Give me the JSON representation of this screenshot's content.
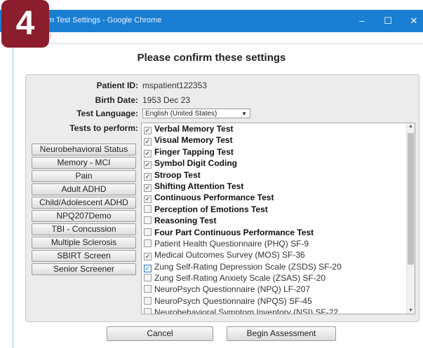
{
  "window": {
    "title": "m Test Settings - Google Chrome",
    "address": "//",
    "controls": [
      "–",
      "☐",
      "✕"
    ]
  },
  "step_badge": "4",
  "heading": "Please confirm these settings",
  "patient": {
    "id_label": "Patient ID:",
    "id_value": "mspatient122353",
    "birth_label": "Birth Date:",
    "birth_value": "1953 Dec 23",
    "language_label": "Test Language:",
    "language_value": "English (United States)",
    "tests_label": "Tests to perform:"
  },
  "presets": [
    "Neurobehavioral Status",
    "Memory - MCI",
    "Pain",
    "Adult ADHD",
    "Child/Adolescent ADHD",
    "NPQ207Demo",
    "TBI - Concussion",
    "Multiple Sclerosis",
    "SBIRT Screen",
    "Senior Screener"
  ],
  "tests": [
    {
      "label": "Verbal Memory Test",
      "checked": true,
      "bold": true
    },
    {
      "label": "Visual Memory Test",
      "checked": true,
      "bold": true
    },
    {
      "label": "Finger Tapping Test",
      "checked": true,
      "bold": true
    },
    {
      "label": "Symbol Digit Coding",
      "checked": true,
      "bold": true
    },
    {
      "label": "Stroop Test",
      "checked": true,
      "bold": true
    },
    {
      "label": "Shifting Attention Test",
      "checked": true,
      "bold": true
    },
    {
      "label": "Continuous Performance Test",
      "checked": true,
      "bold": true
    },
    {
      "label": "Perception of Emotions Test",
      "checked": false,
      "bold": true
    },
    {
      "label": "Reasoning Test",
      "checked": false,
      "bold": true
    },
    {
      "label": "Four Part Continuous Performance Test",
      "checked": false,
      "bold": true
    },
    {
      "label": "Patient Health Questionnaire (PHQ) SF-9",
      "checked": false,
      "bold": false
    },
    {
      "label": "Medical Outcomes Survey (MOS) SF-36",
      "checked": true,
      "bold": false
    },
    {
      "label": "Zung Self-Rating Depression Scale (ZSDS) SF-20",
      "checked": true,
      "bold": false,
      "focused": true
    },
    {
      "label": "Zung Self-Rating Anxiety Scale (ZSAS) SF-20",
      "checked": false,
      "bold": false
    },
    {
      "label": "NeuroPsych Questionnaire (NPQ) LF-207",
      "checked": false,
      "bold": false
    },
    {
      "label": "NeuroPsych Questionnaire (NPQS) SF-45",
      "checked": false,
      "bold": false
    },
    {
      "label": "Neurobehavioral Symptom Inventory (NSI) SF-22",
      "checked": false,
      "bold": false
    }
  ],
  "buttons": {
    "cancel": "Cancel",
    "begin": "Begin Assessment"
  },
  "colors": {
    "titlebar": "#1a7fd3",
    "badge": "#8b1d2c"
  }
}
